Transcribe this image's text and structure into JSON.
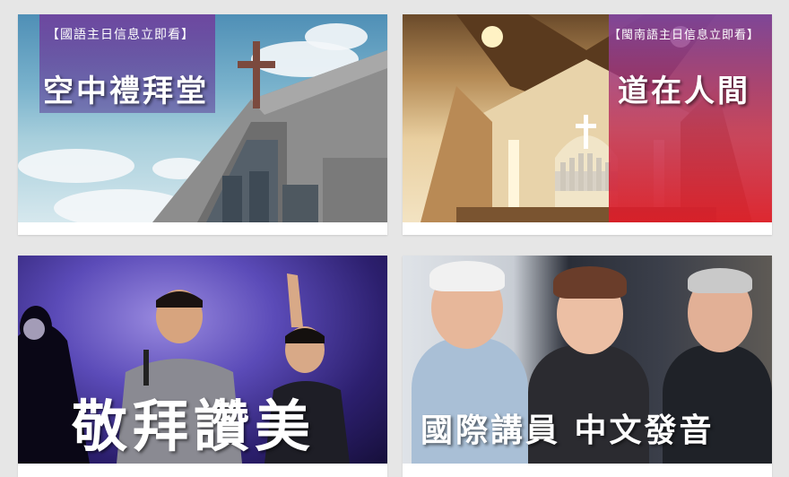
{
  "cards": [
    {
      "tag": "【國語主日信息立即看】",
      "title": "空中禮拜堂"
    },
    {
      "tag": "【閩南語主日信息立即看】",
      "title": "道在人間"
    },
    {
      "title": "敬拜讚美"
    },
    {
      "title": "國際講員 中文發音"
    }
  ],
  "icons": {
    "cross": "cross-icon"
  }
}
